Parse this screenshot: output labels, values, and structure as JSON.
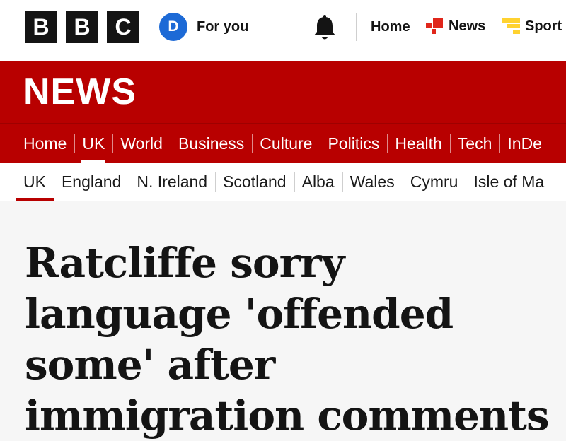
{
  "brand": {
    "logo_letters": [
      "B",
      "B",
      "C"
    ]
  },
  "account": {
    "avatar_initial": "D",
    "for_you_label": "For you"
  },
  "top_nav": {
    "home_label": "Home",
    "news_label": "News",
    "sport_label": "Sport"
  },
  "masthead": {
    "title": "NEWS"
  },
  "section_nav": {
    "items": [
      "Home",
      "UK",
      "World",
      "Business",
      "Culture",
      "Politics",
      "Health",
      "Tech",
      "InDe"
    ],
    "active": "UK"
  },
  "sub_nav": {
    "items": [
      "UK",
      "England",
      "N. Ireland",
      "Scotland",
      "Alba",
      "Wales",
      "Cymru",
      "Isle of Ma"
    ],
    "active": "UK"
  },
  "article": {
    "headline": "Ratcliffe sorry language 'offended some' after immigration comments"
  },
  "colors": {
    "brand_red": "#b80000",
    "avatar_blue": "#1d6ad6",
    "news_icon_red": "#e0261b",
    "sport_icon_yellow": "#ffd230"
  },
  "icons": {
    "notifications": "bell-icon",
    "news": "news-icon",
    "sport": "sport-icon"
  }
}
